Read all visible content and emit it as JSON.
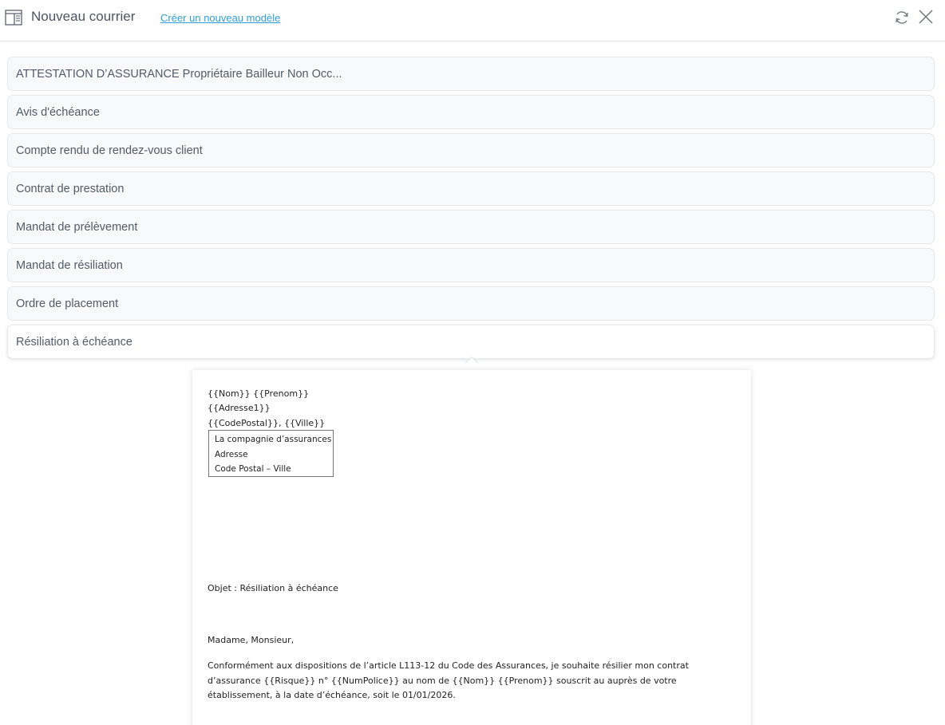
{
  "header": {
    "title": "Nouveau courrier",
    "create_link": "Créer un nouveau modèle",
    "icons": [
      "document-layout-icon",
      "refresh-icon",
      "close-icon"
    ]
  },
  "templates": [
    "ATTESTATION D’ASSURANCE Propriétaire Bailleur Non Occ...",
    "Avis d'échéance",
    "Compte rendu de rendez-vous client",
    "Contrat de prestation",
    "Mandat de prélèvement",
    "Mandat de résiliation",
    "Ordre de placement",
    "Résiliation à échéance"
  ],
  "selected_template": "Résiliation à échéance",
  "preview": {
    "sender_line1": "{{Nom}} {{Prenom}}",
    "sender_line2": "{{Adresse1}}",
    "sender_line3": "{{CodePostal}}, {{Ville}}",
    "recipient": {
      "line1": "La compagnie d’assurances",
      "line2": "Adresse",
      "line3": "Code Postal – Ville"
    },
    "object": "Objet : Résiliation à échéance",
    "greeting": "Madame, Monsieur,",
    "body": "Conformément aux dispositions de l’article L113-12 du Code des Assurances, je souhaite résilier mon contrat d’assurance {{Risque}} n° {{NumPolice}} au nom de {{Nom}} {{Prenom}} souscrit au  auprès de votre établissement, à la date d’échéance, soit le 01/01/2026."
  }
}
